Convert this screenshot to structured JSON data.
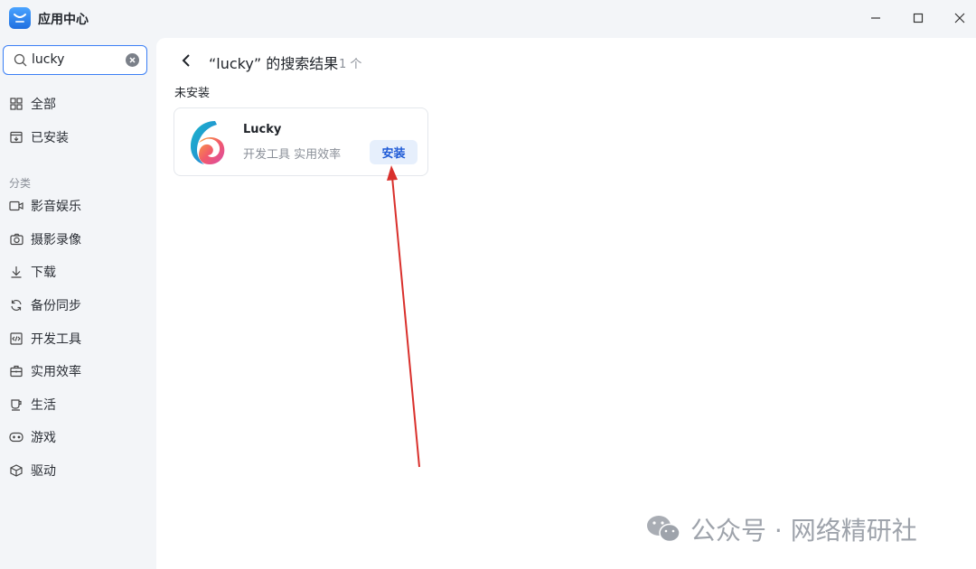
{
  "window": {
    "title": "应用中心",
    "logo_icon": "app-store-icon",
    "controls": {
      "minimize_icon": "minimize-icon",
      "maximize_icon": "maximize-icon",
      "close_icon": "close-icon"
    }
  },
  "search": {
    "value": "lucky",
    "icon": "search-icon",
    "clear_icon": "clear-icon"
  },
  "sidebar": {
    "top_items": [
      {
        "label": "全部",
        "icon": "grid-icon"
      },
      {
        "label": "已安装",
        "icon": "installed-icon"
      }
    ],
    "category_label": "分类",
    "categories": [
      {
        "label": "影音娱乐",
        "icon": "video-icon"
      },
      {
        "label": "摄影录像",
        "icon": "camera-icon"
      },
      {
        "label": "下载",
        "icon": "download-icon"
      },
      {
        "label": "备份同步",
        "icon": "sync-icon"
      },
      {
        "label": "开发工具",
        "icon": "code-icon"
      },
      {
        "label": "实用效率",
        "icon": "toolbox-icon"
      },
      {
        "label": "生活",
        "icon": "cup-icon"
      },
      {
        "label": "游戏",
        "icon": "gamepad-icon"
      },
      {
        "label": "驱动",
        "icon": "cube-icon"
      }
    ]
  },
  "main": {
    "title": "“lucky” 的搜索结果",
    "count": "1 个",
    "section": "未安装",
    "apps": [
      {
        "name": "Lucky",
        "tags": "开发工具 实用效率",
        "action": "安装",
        "icon": "lucky-app-icon"
      }
    ]
  },
  "watermark": {
    "text": "公众号 · 网络精研社",
    "icon": "wechat-icon"
  },
  "colors": {
    "accent": "#3b7ff5",
    "install_bg": "#e6effc",
    "arrow": "#d9302c",
    "sidebar_bg": "#f3f5f8"
  }
}
